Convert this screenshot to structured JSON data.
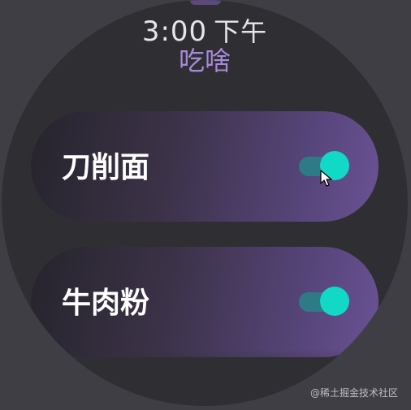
{
  "status": {
    "time": "3:00",
    "ampm": "下午"
  },
  "app": {
    "title": "吃啥"
  },
  "items": [
    {
      "label": "刀削面",
      "toggle_on": true
    },
    {
      "label": "牛肉粉",
      "toggle_on": true
    }
  ],
  "watermark": "@稀土掘金技术社区",
  "colors": {
    "background": "#3f3e44",
    "watch_face": "#2f2f33",
    "title_accent": "#a78ad9",
    "toggle_track": "#2e7a86",
    "toggle_thumb": "#12d8c6"
  },
  "icons": {
    "cursor": "mouse-pointer-icon"
  }
}
